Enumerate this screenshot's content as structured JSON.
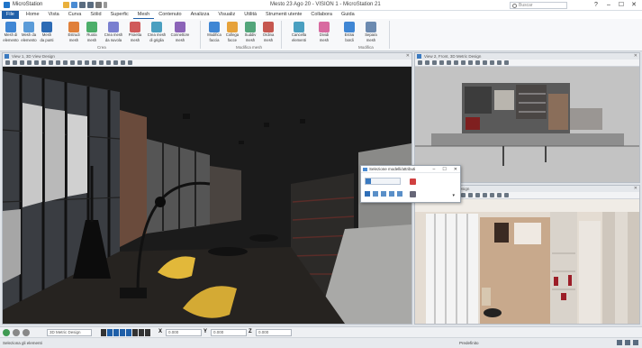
{
  "app": {
    "name": "MicroStation",
    "document": "Mesto 23 Ago 20 - VISION 1 - MicroStation 21",
    "search_placeholder": "Buscar"
  },
  "window_controls": {
    "help": "?",
    "minimize": "–",
    "maximize": "☐",
    "close": "✕"
  },
  "tabs": [
    "File",
    "Home",
    "Vista",
    "Curva",
    "Sólid",
    "Superfic",
    "Mesh",
    "Contenuto",
    "Analizza",
    "Visualiz",
    "Utilità",
    "Strumenti utente",
    "Collabora",
    "Guida"
  ],
  "ribbon": {
    "buttons": [
      {
        "label": "Mesh di",
        "sub": "elemento",
        "color": "#3f86d4"
      },
      {
        "label": "Mesh da",
        "sub": "elemento",
        "color": "#5a9bd8"
      },
      {
        "label": "Mesh",
        "sub": "da punti",
        "color": "#2c6bb5"
      },
      {
        "label": "Estrudi",
        "sub": "mesh",
        "color": "#e0803a"
      },
      {
        "label": "Ruota",
        "sub": "mesh",
        "color": "#4cae6a"
      },
      {
        "label": "Crea mesh",
        "sub": "da nuvola",
        "color": "#7a7fd0"
      },
      {
        "label": "Proietta",
        "sub": "mesh",
        "color": "#d05a5a"
      },
      {
        "label": "Crea mesh",
        "sub": "di griglia",
        "color": "#4a9fc0"
      },
      {
        "label": "Connettore",
        "sub": "mesh",
        "color": "#8c64b8"
      },
      {
        "label": "Modifica",
        "sub": "faccia",
        "color": "#3f86d4"
      },
      {
        "label": "Collega",
        "sub": "facce",
        "color": "#e6a23a"
      },
      {
        "label": "Suddiv",
        "sub": "mesh",
        "color": "#52a57a"
      },
      {
        "label": "Ordina",
        "sub": "mesh",
        "color": "#c6574f"
      },
      {
        "label": "Cancella",
        "sub": "elementi",
        "color": "#4a9fc0"
      },
      {
        "label": "Dividi",
        "sub": "mesh",
        "color": "#d86aa0"
      },
      {
        "label": "Estrai",
        "sub": "bordi",
        "color": "#3f86d4"
      },
      {
        "label": "Separa",
        "sub": "mesh",
        "color": "#6c8ab0"
      }
    ],
    "groups": [
      "Crea",
      "Modifica mesh",
      "Modifica"
    ]
  },
  "views": {
    "main_title": "View 1, 3D View Design",
    "top_right_title": "View 2, Front, 3D Metric Design",
    "bottom_right_title": "View 3, 3D Metric Design"
  },
  "dialog": {
    "title": "Selezione modelli/attributi"
  },
  "statusbar": {
    "model": "3D Metric Design",
    "x_label": "X",
    "x_value": "0.000",
    "y_label": "Y",
    "y_value": "0.000",
    "z_label": "Z",
    "z_value": "0.000",
    "status_left": "Seleziona gli elementi",
    "status_right": "Predefinito"
  },
  "colors": {
    "accent": "#1f5fa8",
    "scene_dark": "#1b1b1b",
    "chair_yellow": "#e2b83a"
  }
}
